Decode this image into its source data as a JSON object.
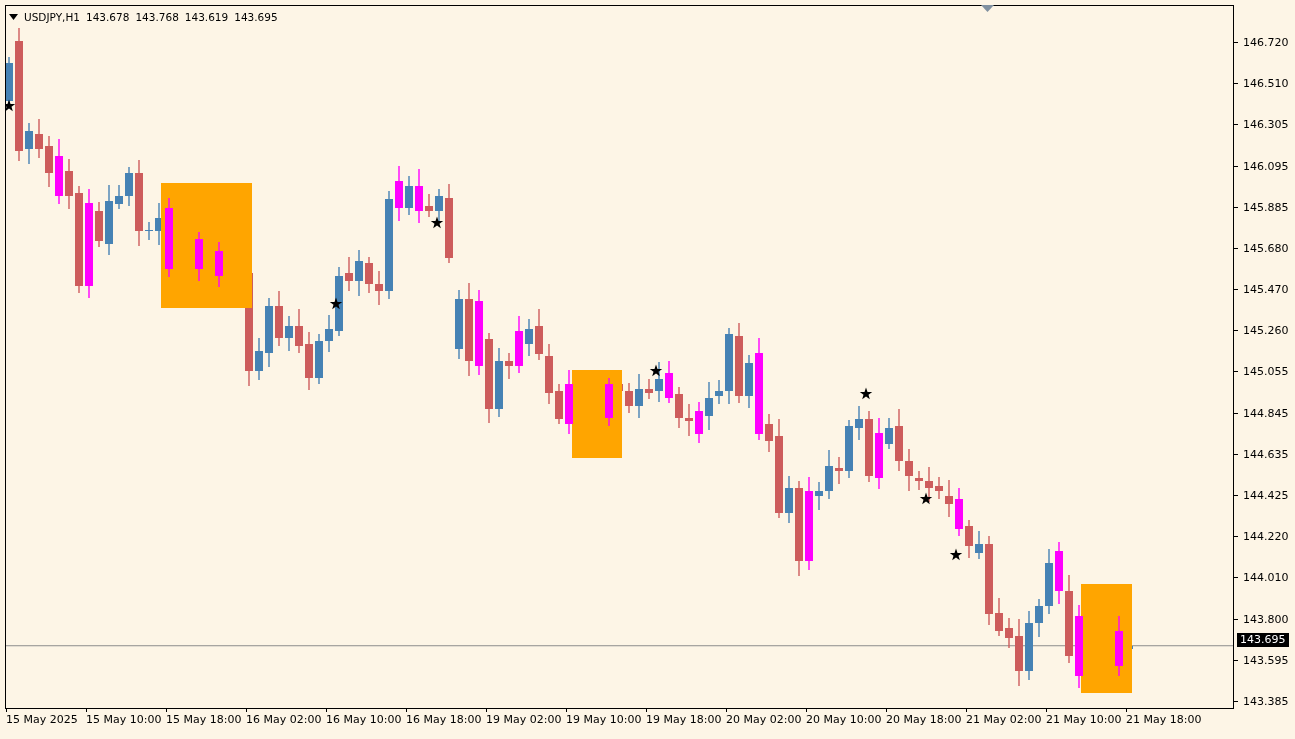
{
  "header": {
    "symbol": "USDJPY,H1",
    "quotes": [
      "143.678",
      "143.768",
      "143.619",
      "143.695"
    ]
  },
  "price_axis": {
    "labels": [
      "146.720",
      "146.510",
      "146.305",
      "146.095",
      "145.885",
      "145.680",
      "145.470",
      "145.260",
      "145.055",
      "144.845",
      "144.635",
      "144.425",
      "144.220",
      "144.010",
      "143.800",
      "143.595",
      "143.385"
    ],
    "current_price": "143.695"
  },
  "time_axis": {
    "labels": [
      "15 May 2025",
      "15 May 10:00",
      "15 May 18:00",
      "16 May 02:00",
      "16 May 10:00",
      "16 May 18:00",
      "19 May 02:00",
      "19 May 10:00",
      "19 May 18:00",
      "20 May 02:00",
      "20 May 10:00",
      "20 May 18:00",
      "21 May 02:00",
      "21 May 10:00",
      "21 May 18:00"
    ]
  }
}
